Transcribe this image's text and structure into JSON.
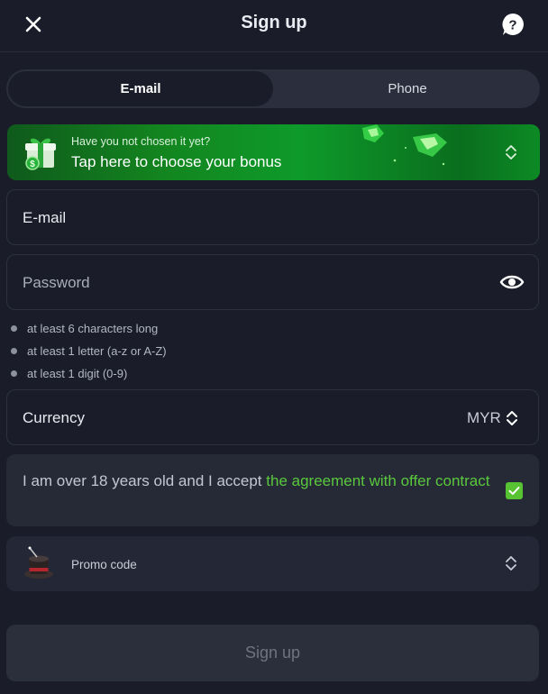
{
  "header": {
    "title": "Sign up"
  },
  "tabs": [
    {
      "label": "E-mail",
      "active": true
    },
    {
      "label": "Phone",
      "active": false
    }
  ],
  "bonus": {
    "subtitle": "Have you not chosen it yet?",
    "title": "Tap here to choose your bonus"
  },
  "email_field": {
    "label": "E-mail"
  },
  "password_field": {
    "placeholder": "Password"
  },
  "password_rules": [
    "at least 6 characters long",
    "at least 1 letter (a-z or A-Z)",
    "at least 1 digit (0-9)"
  ],
  "currency": {
    "label": "Currency",
    "value": "MYR"
  },
  "agreement": {
    "text": "I am over 18 years old and I accept ",
    "link": "the agreement with offer contract",
    "checked": true
  },
  "promo": {
    "label": "Promo code"
  },
  "submit": {
    "label": "Sign up"
  },
  "colors": {
    "background": "#1a1d29",
    "accent_green": "#58c332",
    "bonus_green": "#13861f"
  },
  "icons": [
    "close-icon",
    "help-icon",
    "gift-icon",
    "chevron-updown-icon",
    "eye-icon",
    "check-icon",
    "magic-hat-icon"
  ]
}
